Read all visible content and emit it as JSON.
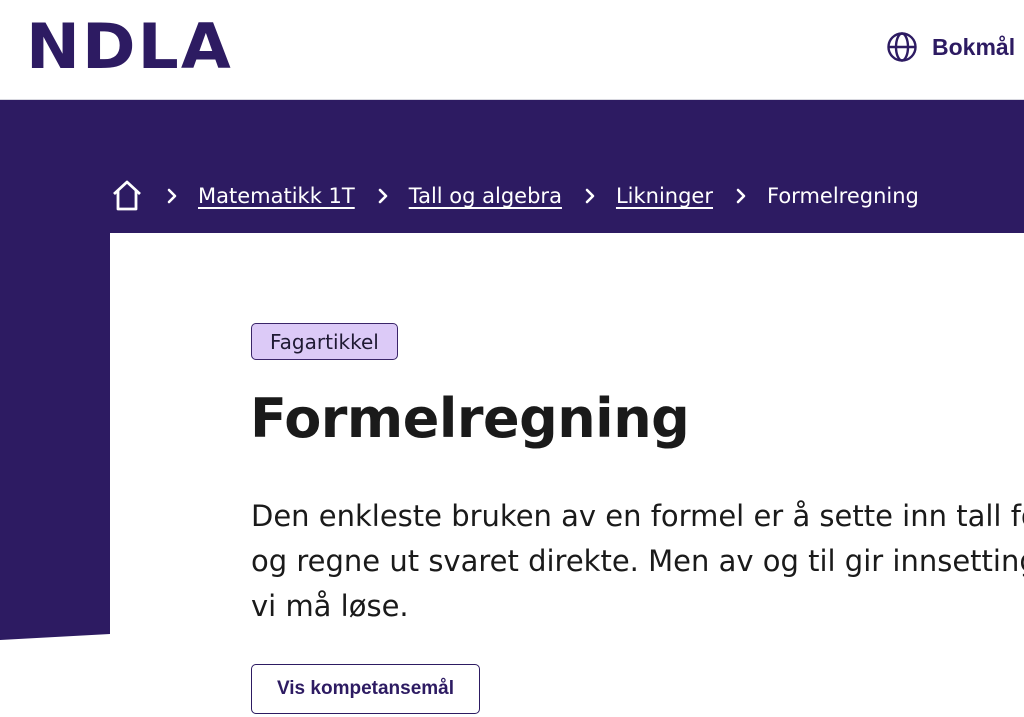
{
  "header": {
    "logo_text": "NDLA",
    "language_label": "Bokmål",
    "language_icon": "globe-icon"
  },
  "colors": {
    "brand_purple": "#2d1b62",
    "tag_background": "#dccaf7"
  },
  "breadcrumb": {
    "home_icon": "home-icon",
    "separator_icon": "chevron-right-icon",
    "items": [
      {
        "label": "Matematikk 1T"
      },
      {
        "label": "Tall og algebra"
      },
      {
        "label": "Likninger"
      }
    ],
    "current": "Formelregning"
  },
  "article": {
    "tag": "Fagartikkel",
    "title": "Formelregning",
    "ingress_lines": [
      "Den enkleste bruken av en formel er å sette inn tall for",
      "og regne ut svaret direkte. Men av og til gir innsetting",
      "vi må løse."
    ],
    "competence_button": "Vis kompetansemål"
  }
}
